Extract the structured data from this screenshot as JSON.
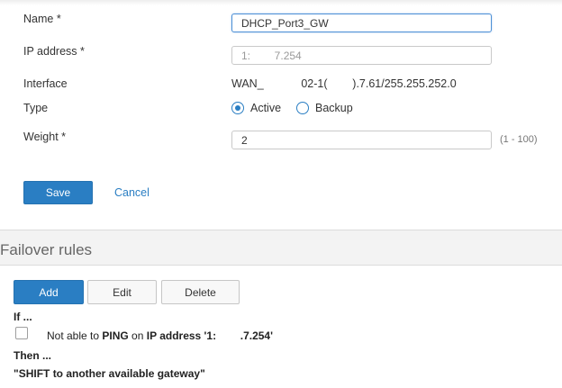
{
  "form": {
    "name": {
      "label": "Name *",
      "value": "DHCP_Port3_GW"
    },
    "ip_address": {
      "label": "IP address *",
      "value": "1:        7.254"
    },
    "interface": {
      "label": "Interface",
      "value": "WAN_            02-1(        ).7.61/255.255.252.0"
    },
    "type": {
      "label": "Type",
      "options": [
        {
          "label": "Active",
          "selected": true
        },
        {
          "label": "Backup",
          "selected": false
        }
      ]
    },
    "weight": {
      "label": "Weight *",
      "value": "2",
      "hint": "(1 - 100)"
    },
    "save_label": "Save",
    "cancel_label": "Cancel"
  },
  "failover": {
    "title": "Failover rules",
    "buttons": {
      "add": "Add",
      "edit": "Edit",
      "delete": "Delete"
    },
    "if_label": "If ...",
    "rule": {
      "pre": "Not able to ",
      "ping": "PING",
      "mid": " on ",
      "ip_label": "IP address '1:        .7.254'",
      "checked": false
    },
    "then_label": "Then ...",
    "action": "\"SHIFT to another available gateway\""
  },
  "colors": {
    "accent": "#2a7ec3",
    "section_bg": "#f3f3f3",
    "input_border": "#c9c9c9"
  }
}
